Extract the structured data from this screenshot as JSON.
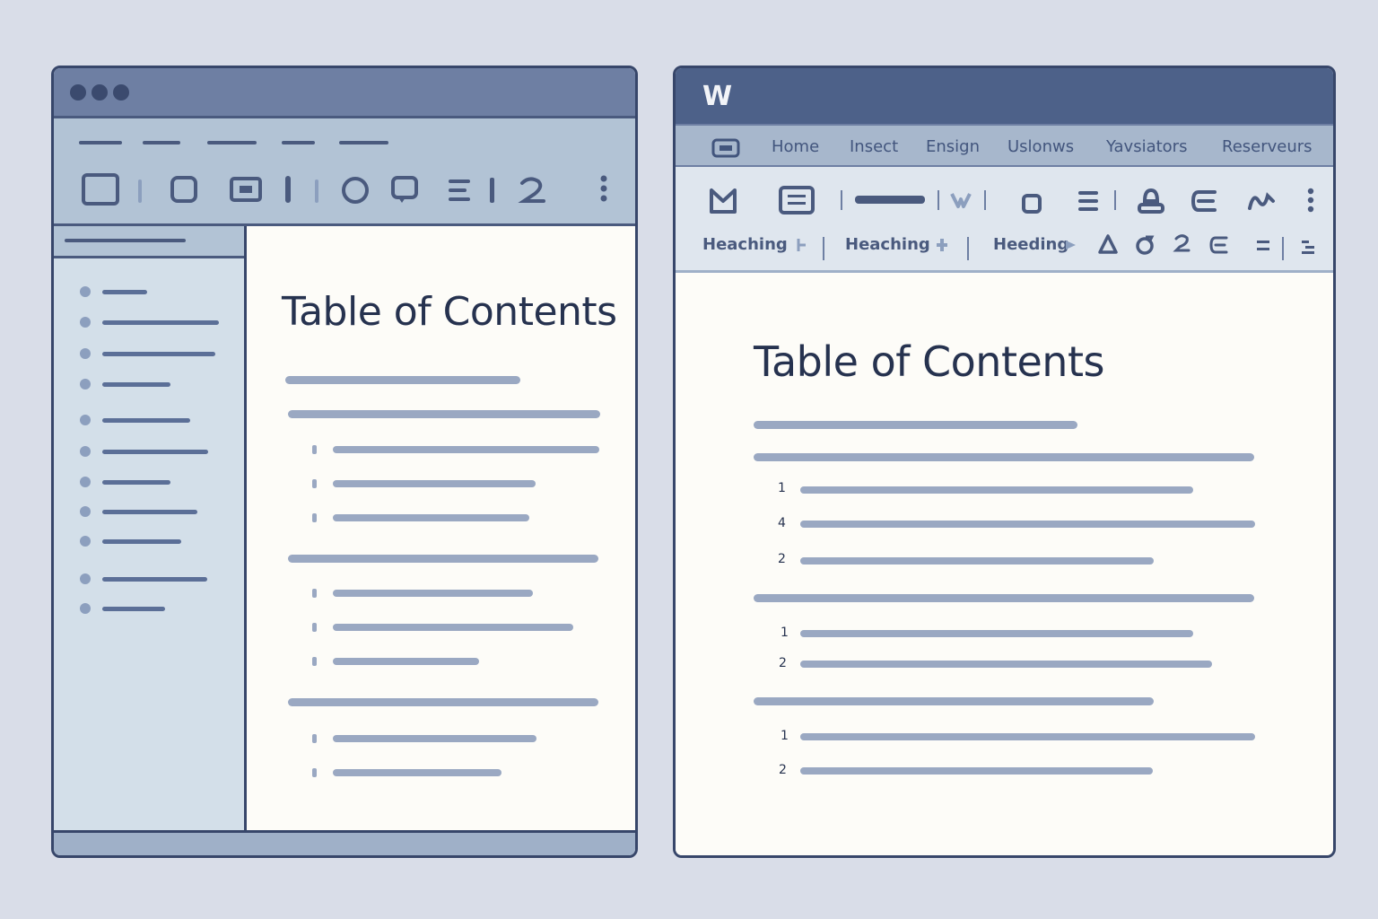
{
  "left_window": {
    "document": {
      "title": "Table of Contents"
    }
  },
  "right_window": {
    "app_logo": "W",
    "menu": [
      "Home",
      "Insect",
      "Ensign",
      "Uslonws",
      "Yavsiators",
      "Reserveurs"
    ],
    "styles": [
      "Heaching",
      "Heaching",
      "Heeding"
    ],
    "document": {
      "title": "Table of Contents",
      "numbers": [
        "1",
        "4",
        "2",
        "1",
        "2",
        "1",
        "2"
      ]
    }
  },
  "colors": {
    "background": "#d9dde8",
    "frame": "#37466a",
    "title_bar_left": "#6e7fa3",
    "title_bar_right": "#4d6189",
    "toolbar": "#b2c3d5",
    "sidebar": "#d3dfe9",
    "page": "#fdfcf8",
    "placeholder_line": "#9aa8c2"
  }
}
